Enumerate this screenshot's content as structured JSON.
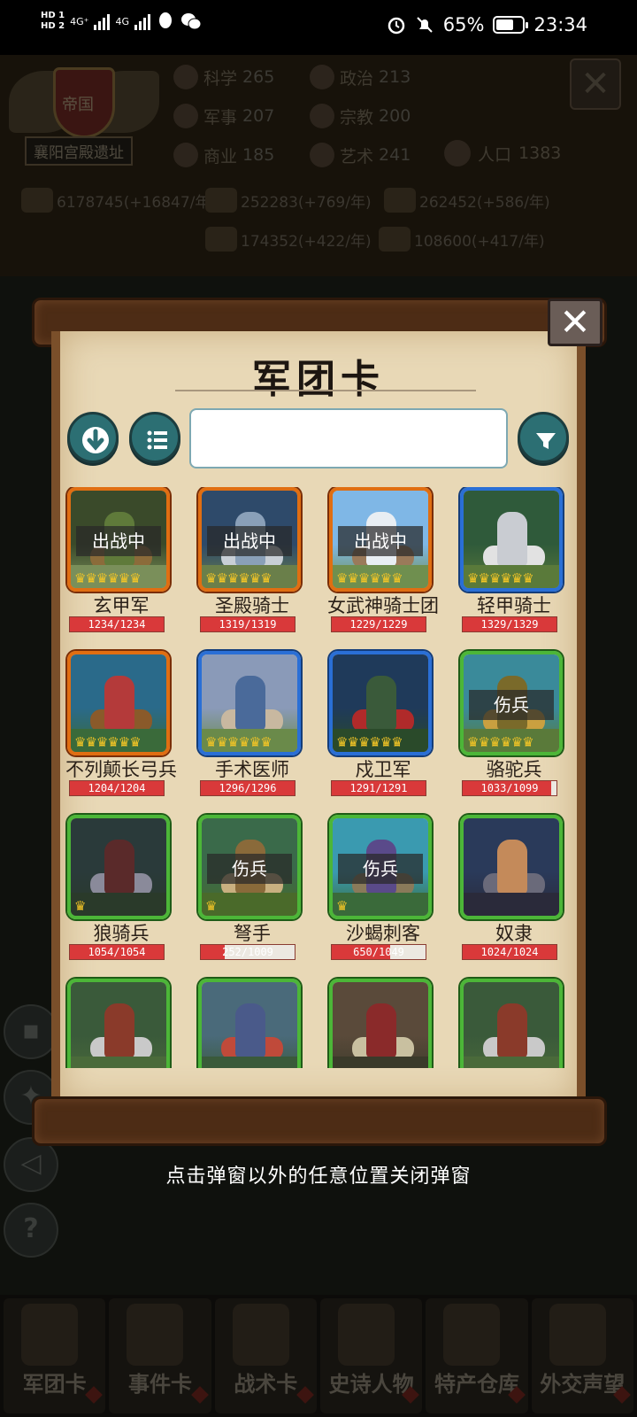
{
  "status_bar": {
    "hd_top": "HD 1",
    "hd_bottom": "HD 2",
    "net1": "4G⁺",
    "net2": "4G",
    "battery": "65%",
    "time": "23:34"
  },
  "empire": {
    "badge": "帝国",
    "name": "襄阳宫殿遗址",
    "stats": [
      {
        "label": "科学",
        "value": "265",
        "icon": "science-icon"
      },
      {
        "label": "政治",
        "value": "213",
        "icon": "politics-icon"
      },
      {
        "label": "军事",
        "value": "207",
        "icon": "military-icon"
      },
      {
        "label": "宗教",
        "value": "200",
        "icon": "religion-icon"
      },
      {
        "label": "商业",
        "value": "185",
        "icon": "commerce-icon"
      },
      {
        "label": "艺术",
        "value": "241",
        "icon": "art-icon"
      }
    ],
    "population": {
      "label": "人口",
      "value": "1383"
    },
    "resources": [
      "6178745(+16847/年)",
      "252283(+769/年)",
      "262452(+586/年)",
      "174352(+422/年)",
      "108600(+417/年)"
    ]
  },
  "bottom_nav": [
    "军团卡",
    "事件卡",
    "战术卡",
    "史诗人物",
    "特产仓库",
    "外交声望"
  ],
  "popup": {
    "title": "军团卡",
    "search_value": "",
    "close_symbol": "✕",
    "hint": "点击弹窗以外的任意位置关闭弹窗",
    "cards": [
      {
        "name": "玄甲军",
        "hp": "1234/1234",
        "hp_fraction": 1.0,
        "rarity": "orange",
        "status": "出战中",
        "crowns": "♛♛♛♛♛♛"
      },
      {
        "name": "圣殿骑士",
        "hp": "1319/1319",
        "hp_fraction": 1.0,
        "rarity": "orange",
        "status": "出战中",
        "crowns": "♛♛♛♛♛♛"
      },
      {
        "name": "女武神骑士团",
        "hp": "1229/1229",
        "hp_fraction": 1.0,
        "rarity": "orange",
        "status": "出战中",
        "crowns": "♛♛♛♛♛♛"
      },
      {
        "name": "轻甲骑士",
        "hp": "1329/1329",
        "hp_fraction": 1.0,
        "rarity": "blue",
        "status": "",
        "crowns": "♛♛♛♛♛♛"
      },
      {
        "name": "不列颠长弓兵",
        "hp": "1204/1204",
        "hp_fraction": 1.0,
        "rarity": "orange",
        "status": "",
        "crowns": "♛♛♛♛♛♛"
      },
      {
        "name": "手术医师",
        "hp": "1296/1296",
        "hp_fraction": 1.0,
        "rarity": "blue",
        "status": "",
        "crowns": "♛♛♛♛♛♛"
      },
      {
        "name": "戍卫军",
        "hp": "1291/1291",
        "hp_fraction": 1.0,
        "rarity": "blue",
        "status": "",
        "crowns": "♛♛♛♛♛♛"
      },
      {
        "name": "骆驼兵",
        "hp": "1033/1099",
        "hp_fraction": 0.94,
        "rarity": "green",
        "status": "伤兵",
        "crowns": "♛♛♛♛♛♛"
      },
      {
        "name": "狼骑兵",
        "hp": "1054/1054",
        "hp_fraction": 1.0,
        "rarity": "green",
        "status": "",
        "crowns": "♛"
      },
      {
        "name": "弩手",
        "hp": "252/1009",
        "hp_fraction": 0.25,
        "rarity": "green",
        "status": "伤兵",
        "crowns": "♛"
      },
      {
        "name": "沙蝎刺客",
        "hp": "650/1049",
        "hp_fraction": 0.62,
        "rarity": "green",
        "status": "伤兵",
        "crowns": "♛"
      },
      {
        "name": "奴隶",
        "hp": "1024/1024",
        "hp_fraction": 1.0,
        "rarity": "green",
        "status": "",
        "crowns": ""
      },
      {
        "name": "",
        "hp": "",
        "hp_fraction": 1.0,
        "rarity": "green",
        "status": "",
        "crowns": ""
      },
      {
        "name": "",
        "hp": "",
        "hp_fraction": 1.0,
        "rarity": "green",
        "status": "",
        "crowns": ""
      },
      {
        "name": "",
        "hp": "",
        "hp_fraction": 1.0,
        "rarity": "green",
        "status": "",
        "crowns": ""
      },
      {
        "name": "",
        "hp": "",
        "hp_fraction": 1.0,
        "rarity": "green",
        "status": "",
        "crowns": ""
      }
    ]
  },
  "icons": {
    "sort": "sort-down-icon",
    "list": "list-icon",
    "filter": "filter-icon",
    "close": "close-icon"
  },
  "colors": {
    "rarity_orange": "#e06e12",
    "rarity_blue": "#2a6fd6",
    "rarity_green": "#4cb638",
    "hp_fill": "#d9393a",
    "button_teal": "#2c6f73"
  }
}
